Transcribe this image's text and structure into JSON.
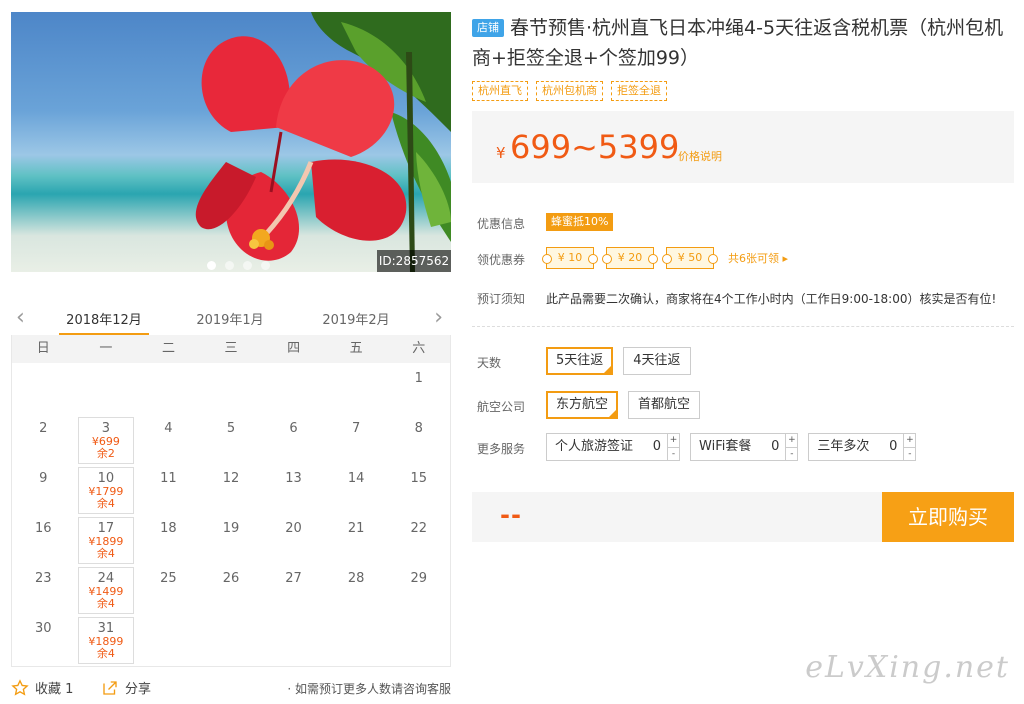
{
  "hero": {
    "id_badge": "ID:2857562",
    "dots": 4,
    "active_dot": 0
  },
  "calendar": {
    "prev_icon": "chevron-left-icon",
    "next_icon": "chevron-right-icon",
    "months": [
      "2018年12月",
      "2019年1月",
      "2019年2月"
    ],
    "active_month": 0,
    "weekdays": [
      "日",
      "一",
      "二",
      "三",
      "四",
      "五",
      "六"
    ],
    "leading_blanks": 6,
    "days": 31,
    "available": {
      "3": {
        "price": "¥699",
        "remain": "余2"
      },
      "10": {
        "price": "¥1799",
        "remain": "余4"
      },
      "17": {
        "price": "¥1899",
        "remain": "余4"
      },
      "24": {
        "price": "¥1499",
        "remain": "余4"
      },
      "31": {
        "price": "¥1899",
        "remain": "余4"
      }
    }
  },
  "footer": {
    "favorite_label": "收藏 1",
    "share_label": "分享",
    "note": "· 如需预订更多人数请咨询客服"
  },
  "product": {
    "shop_badge": "店铺",
    "title": "春节预售·杭州直飞日本冲绳4-5天往返含税机票（杭州包机商+拒签全退+个签加99）",
    "tags": [
      "杭州直飞",
      "杭州包机商",
      "拒签全退"
    ],
    "price": {
      "currency": "¥",
      "amount": "699~5399",
      "explain": "价格说明"
    },
    "promo": {
      "label": "优惠信息",
      "badge": "蜂蜜抵10%"
    },
    "coupons": {
      "label": "领优惠券",
      "items": [
        "¥ 10",
        "¥ 20",
        "¥ 50"
      ],
      "more": "共6张可领 ▸"
    },
    "notice": {
      "label": "预订须知",
      "text": "此产品需要二次确认，商家将在4个工作小时内（工作日9:00-18:00）核实是否有位!"
    },
    "days": {
      "label": "天数",
      "options": [
        "5天往返",
        "4天往返"
      ],
      "selected": 0
    },
    "airline": {
      "label": "航空公司",
      "options": [
        "东方航空",
        "首都航空"
      ],
      "selected": 0
    },
    "services": {
      "label": "更多服务",
      "items": [
        {
          "name": "个人旅游签证",
          "qty": "0"
        },
        {
          "name": "WiFi套餐",
          "qty": "0"
        },
        {
          "name": "三年多次",
          "qty": "0"
        }
      ]
    },
    "total": "--",
    "buy_label": "立即购买"
  },
  "watermark": "eLvXing.net",
  "colors": {
    "accent": "#f39c12",
    "price": "#f05a14",
    "buy": "#f7a015",
    "shop_badge": "#3fa4e8"
  }
}
